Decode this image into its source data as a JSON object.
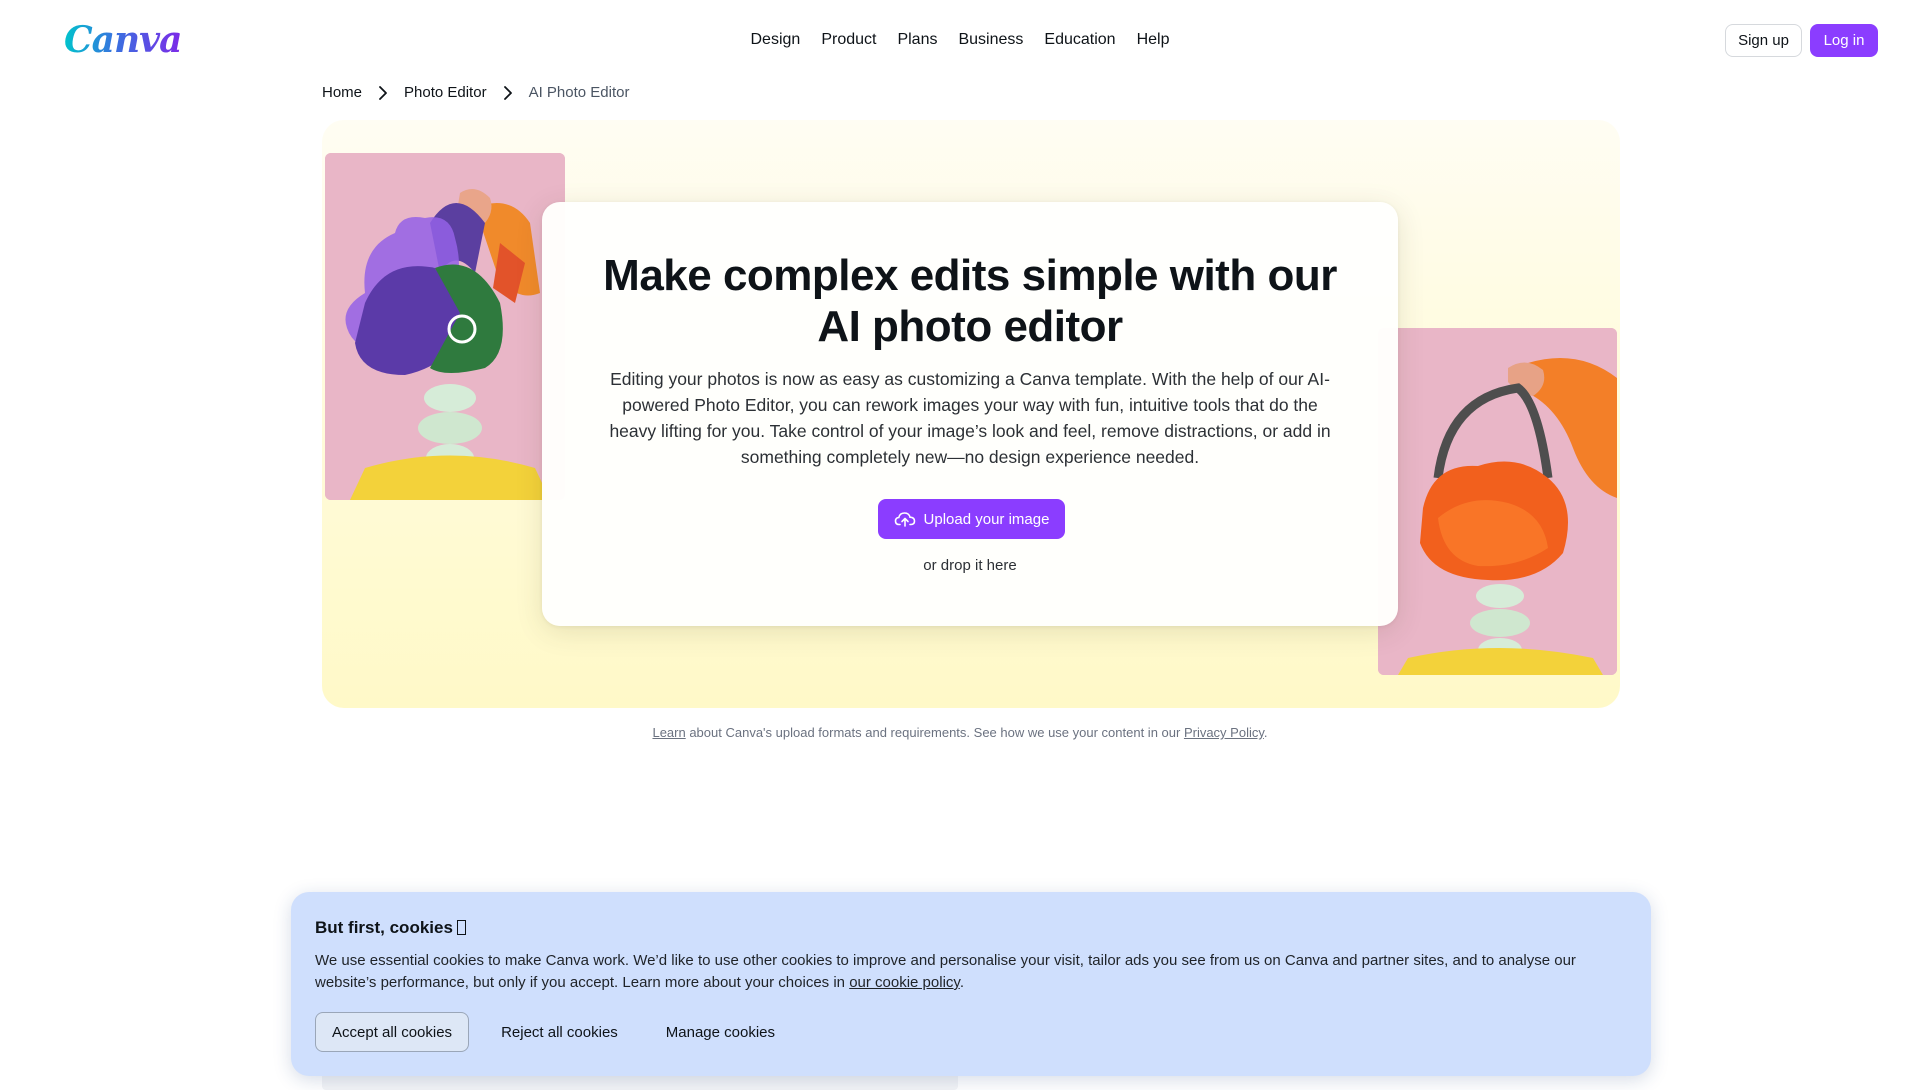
{
  "header": {
    "logo_text": "Canva",
    "nav": [
      "Design",
      "Product",
      "Plans",
      "Business",
      "Education",
      "Help"
    ],
    "signup_label": "Sign up",
    "login_label": "Log in",
    "logo_gradient": [
      "#00c4cc",
      "#3a6fe0",
      "#7d2ae8"
    ],
    "accent_color": "#8b3dff"
  },
  "breadcrumb": {
    "items": [
      "Home",
      "Photo Editor",
      "AI Photo Editor"
    ],
    "separator_icon": "chevron-right-icon"
  },
  "hero": {
    "title": "Make complex edits simple with our AI photo editor",
    "description": "Editing your photos is now as easy as customizing a Canva template. With the help of our AI-powered Photo Editor, you can rework images your way with fun, intuitive tools that do the heavy lifting for you. Take control of your image’s look and feel, remove distractions, or add in something completely new—no design experience needed.",
    "upload_label": "Upload your image",
    "upload_icon": "cloud-upload-icon",
    "drop_text": "or drop it here",
    "left_image": "purple-green-handbag-photo",
    "right_image": "orange-fur-handbag-photo"
  },
  "note": {
    "learn_link": "Learn",
    "middle_text": " about Canva's upload formats and requirements. See how we use your content in our ",
    "privacy_link": "Privacy Policy",
    "end_text": "."
  },
  "cookie": {
    "title": "But first, cookies",
    "text": "We use essential cookies to make Canva work. We’d like to use other cookies to improve and personalise your visit, tailor ads you see from us on Canva and partner sites, and to analyse our website’s performance, but only if you accept. Learn more about your choices in ",
    "policy_link": "our cookie policy",
    "text_end": ".",
    "accept_label": "Accept all cookies",
    "reject_label": "Reject all cookies",
    "manage_label": "Manage cookies",
    "background_color": "#cfdffd"
  }
}
